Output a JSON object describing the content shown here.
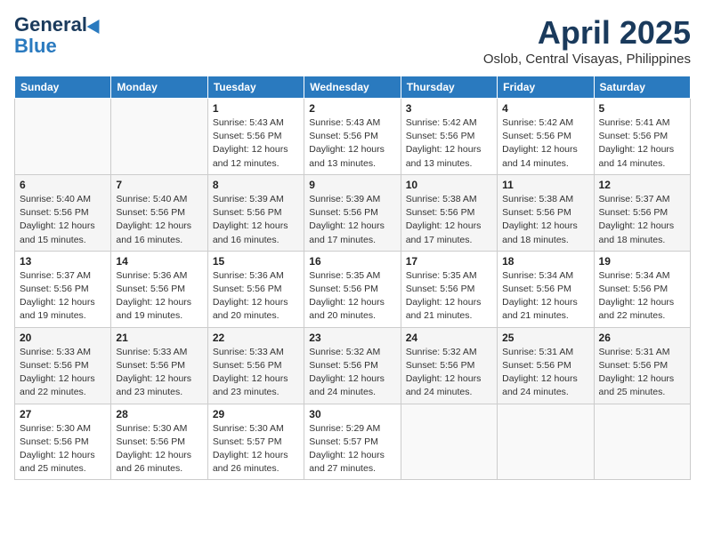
{
  "header": {
    "logo_general": "General",
    "logo_blue": "Blue",
    "title": "April 2025",
    "location": "Oslob, Central Visayas, Philippines"
  },
  "weekdays": [
    "Sunday",
    "Monday",
    "Tuesday",
    "Wednesday",
    "Thursday",
    "Friday",
    "Saturday"
  ],
  "weeks": [
    [
      {
        "day": "",
        "detail": ""
      },
      {
        "day": "",
        "detail": ""
      },
      {
        "day": "1",
        "detail": "Sunrise: 5:43 AM\nSunset: 5:56 PM\nDaylight: 12 hours\nand 12 minutes."
      },
      {
        "day": "2",
        "detail": "Sunrise: 5:43 AM\nSunset: 5:56 PM\nDaylight: 12 hours\nand 13 minutes."
      },
      {
        "day": "3",
        "detail": "Sunrise: 5:42 AM\nSunset: 5:56 PM\nDaylight: 12 hours\nand 13 minutes."
      },
      {
        "day": "4",
        "detail": "Sunrise: 5:42 AM\nSunset: 5:56 PM\nDaylight: 12 hours\nand 14 minutes."
      },
      {
        "day": "5",
        "detail": "Sunrise: 5:41 AM\nSunset: 5:56 PM\nDaylight: 12 hours\nand 14 minutes."
      }
    ],
    [
      {
        "day": "6",
        "detail": "Sunrise: 5:40 AM\nSunset: 5:56 PM\nDaylight: 12 hours\nand 15 minutes."
      },
      {
        "day": "7",
        "detail": "Sunrise: 5:40 AM\nSunset: 5:56 PM\nDaylight: 12 hours\nand 16 minutes."
      },
      {
        "day": "8",
        "detail": "Sunrise: 5:39 AM\nSunset: 5:56 PM\nDaylight: 12 hours\nand 16 minutes."
      },
      {
        "day": "9",
        "detail": "Sunrise: 5:39 AM\nSunset: 5:56 PM\nDaylight: 12 hours\nand 17 minutes."
      },
      {
        "day": "10",
        "detail": "Sunrise: 5:38 AM\nSunset: 5:56 PM\nDaylight: 12 hours\nand 17 minutes."
      },
      {
        "day": "11",
        "detail": "Sunrise: 5:38 AM\nSunset: 5:56 PM\nDaylight: 12 hours\nand 18 minutes."
      },
      {
        "day": "12",
        "detail": "Sunrise: 5:37 AM\nSunset: 5:56 PM\nDaylight: 12 hours\nand 18 minutes."
      }
    ],
    [
      {
        "day": "13",
        "detail": "Sunrise: 5:37 AM\nSunset: 5:56 PM\nDaylight: 12 hours\nand 19 minutes."
      },
      {
        "day": "14",
        "detail": "Sunrise: 5:36 AM\nSunset: 5:56 PM\nDaylight: 12 hours\nand 19 minutes."
      },
      {
        "day": "15",
        "detail": "Sunrise: 5:36 AM\nSunset: 5:56 PM\nDaylight: 12 hours\nand 20 minutes."
      },
      {
        "day": "16",
        "detail": "Sunrise: 5:35 AM\nSunset: 5:56 PM\nDaylight: 12 hours\nand 20 minutes."
      },
      {
        "day": "17",
        "detail": "Sunrise: 5:35 AM\nSunset: 5:56 PM\nDaylight: 12 hours\nand 21 minutes."
      },
      {
        "day": "18",
        "detail": "Sunrise: 5:34 AM\nSunset: 5:56 PM\nDaylight: 12 hours\nand 21 minutes."
      },
      {
        "day": "19",
        "detail": "Sunrise: 5:34 AM\nSunset: 5:56 PM\nDaylight: 12 hours\nand 22 minutes."
      }
    ],
    [
      {
        "day": "20",
        "detail": "Sunrise: 5:33 AM\nSunset: 5:56 PM\nDaylight: 12 hours\nand 22 minutes."
      },
      {
        "day": "21",
        "detail": "Sunrise: 5:33 AM\nSunset: 5:56 PM\nDaylight: 12 hours\nand 23 minutes."
      },
      {
        "day": "22",
        "detail": "Sunrise: 5:33 AM\nSunset: 5:56 PM\nDaylight: 12 hours\nand 23 minutes."
      },
      {
        "day": "23",
        "detail": "Sunrise: 5:32 AM\nSunset: 5:56 PM\nDaylight: 12 hours\nand 24 minutes."
      },
      {
        "day": "24",
        "detail": "Sunrise: 5:32 AM\nSunset: 5:56 PM\nDaylight: 12 hours\nand 24 minutes."
      },
      {
        "day": "25",
        "detail": "Sunrise: 5:31 AM\nSunset: 5:56 PM\nDaylight: 12 hours\nand 24 minutes."
      },
      {
        "day": "26",
        "detail": "Sunrise: 5:31 AM\nSunset: 5:56 PM\nDaylight: 12 hours\nand 25 minutes."
      }
    ],
    [
      {
        "day": "27",
        "detail": "Sunrise: 5:30 AM\nSunset: 5:56 PM\nDaylight: 12 hours\nand 25 minutes."
      },
      {
        "day": "28",
        "detail": "Sunrise: 5:30 AM\nSunset: 5:56 PM\nDaylight: 12 hours\nand 26 minutes."
      },
      {
        "day": "29",
        "detail": "Sunrise: 5:30 AM\nSunset: 5:57 PM\nDaylight: 12 hours\nand 26 minutes."
      },
      {
        "day": "30",
        "detail": "Sunrise: 5:29 AM\nSunset: 5:57 PM\nDaylight: 12 hours\nand 27 minutes."
      },
      {
        "day": "",
        "detail": ""
      },
      {
        "day": "",
        "detail": ""
      },
      {
        "day": "",
        "detail": ""
      }
    ]
  ]
}
